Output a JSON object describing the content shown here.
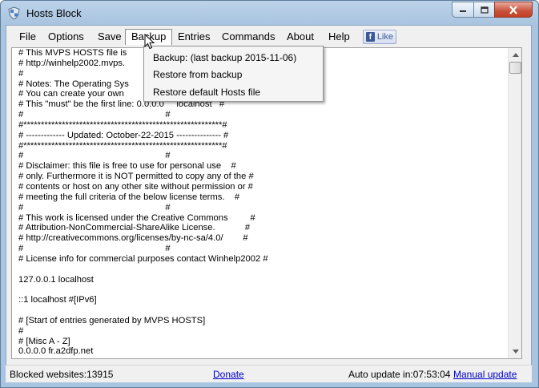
{
  "window": {
    "title": "Hosts Block"
  },
  "menu": {
    "items": [
      "File",
      "Options",
      "Save",
      "Backup",
      "Entries",
      "Commands",
      "About",
      "Help"
    ],
    "open_item": "Backup",
    "facebook_label": "Like"
  },
  "backup_menu": {
    "items": [
      "Backup: (last backup 2015-11-06)",
      "Restore from backup",
      "Restore default Hosts file"
    ]
  },
  "editor": {
    "lines": [
      "# This MVPS HOSTS file is",
      "# http://winhelp2002.mvps.",
      "#",
      "# Notes: The Operating Sys",
      "# You can create your own",
      "# This \"must\" be the first line: 0.0.0.0     localhost   #",
      "#                                                         #",
      "#*********************************************************#",
      "# ------------- Updated: October-22-2015 --------------- #",
      "#*********************************************************#",
      "#                                                         #",
      "# Disclaimer: this file is free to use for personal use    #",
      "# only. Furthermore it is NOT permitted to copy any of the #",
      "# contents or host on any other site without permission or #",
      "# meeting the full criteria of the below license terms.    #",
      "#                                                         #",
      "# This work is licensed under the Creative Commons         #",
      "# Attribution-NonCommercial-ShareAlike License.            #",
      "# http://creativecommons.org/licenses/by-nc-sa/4.0/        #",
      "#                                                         #",
      "# License info for commercial purposes contact Winhelp2002 #",
      "",
      "127.0.0.1 localhost",
      "",
      "::1 localhost #[IPv6]",
      "",
      "# [Start of entries generated by MVPS HOSTS]",
      "#",
      "# [Misc A - Z]",
      "0.0.0.0 fr.a2dfp.net"
    ]
  },
  "status": {
    "blocked": "Blocked websites:13915",
    "donate": "Donate",
    "auto_update": "Auto update in:07:53:04",
    "manual_update": "Manual update"
  },
  "colors": {
    "titlebar": "#a9c4e0",
    "close_button": "#c7513a",
    "link": "#0000cc",
    "facebook": "#3b5998"
  }
}
